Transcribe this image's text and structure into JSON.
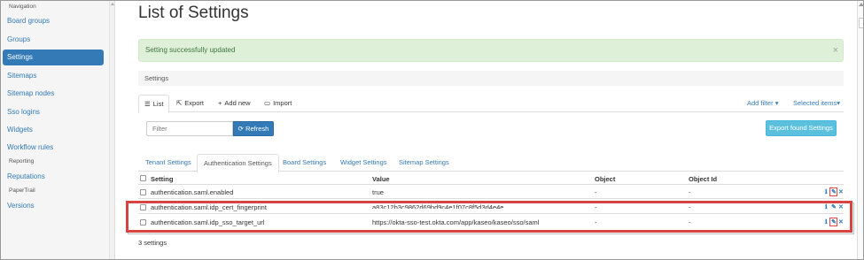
{
  "sidebar": {
    "header": "Navigation",
    "items": [
      {
        "label": "Board groups"
      },
      {
        "label": "Groups"
      },
      {
        "label": "Settings"
      },
      {
        "label": "Sitemaps"
      },
      {
        "label": "Sitemap nodes"
      },
      {
        "label": "Sso logins"
      },
      {
        "label": "Widgets"
      },
      {
        "label": "Workflow rules"
      },
      {
        "label": "Reporting"
      },
      {
        "label": "Reputations"
      },
      {
        "label": "PaperTrail"
      },
      {
        "label": "Versions"
      }
    ],
    "active": "Settings"
  },
  "page": {
    "title": "List of Settings"
  },
  "alert": {
    "message": "Setting successfully updated",
    "close": "×"
  },
  "panel": {
    "heading": "Settings"
  },
  "toolbar": {
    "tabs": [
      {
        "icon": "list-icon",
        "label": "List"
      },
      {
        "icon": "export-icon",
        "label": "Export"
      },
      {
        "icon": "plus-icon",
        "label": "Add new"
      },
      {
        "icon": "folder-icon",
        "label": "Import"
      }
    ],
    "add_filter": "Add filter",
    "selected_items": "Selected items"
  },
  "filter": {
    "placeholder": "Filter",
    "refresh_label": "Refresh",
    "export_found_label": "Export found Settings"
  },
  "subtabs": [
    {
      "label": "Tenant Settings"
    },
    {
      "label": "Authentication Settings"
    },
    {
      "label": "Board Settings"
    },
    {
      "label": "Widget Settings"
    },
    {
      "label": "Sitemap Settings"
    }
  ],
  "active_subtab": "Authentication Settings",
  "table": {
    "headers": [
      "Setting",
      "Value",
      "Object",
      "Object Id"
    ],
    "rows": [
      {
        "setting": "authentication.saml.enabled",
        "value": "true",
        "object": "-",
        "object_id": "-"
      },
      {
        "setting": "authentication.saml.idp_cert_fingerprint",
        "value": "a83c12b3c9862d69bd9c4e1f07c8f5d3d4e4e737",
        "object": "-",
        "object_id": "-"
      },
      {
        "setting": "authentication.saml.idp_sso_target_url",
        "value": "https://okta-sso-test.okta.com/app/kaseo/kaseo/sso/saml",
        "object": "-",
        "object_id": "-"
      }
    ],
    "count_label": "3 settings"
  },
  "colors": {
    "primary": "#337ab7",
    "success_bg": "#dff0d8",
    "success_text": "#3c763d",
    "info_button": "#5bc0de",
    "highlight": "#d64541"
  }
}
